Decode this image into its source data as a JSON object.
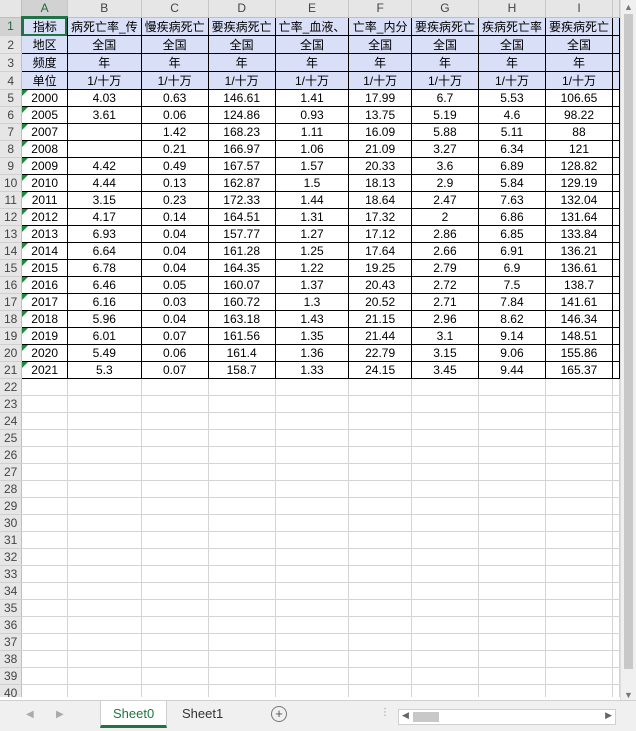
{
  "columns": [
    "A",
    "B",
    "C",
    "D",
    "E",
    "F",
    "G",
    "H",
    "I"
  ],
  "header_rows": [
    [
      "指标",
      "病死亡率_传",
      "慢疾病死亡",
      "要疾病死亡",
      "亡率_血液、",
      "亡率_内分",
      "要疾病死亡",
      "疾病死亡率",
      "要疾病死亡"
    ],
    [
      "地区",
      "全国",
      "全国",
      "全国",
      "全国",
      "全国",
      "全国",
      "全国",
      "全国"
    ],
    [
      "频度",
      "年",
      "年",
      "年",
      "年",
      "年",
      "年",
      "年",
      "年"
    ],
    [
      "单位",
      "1/十万",
      "1/十万",
      "1/十万",
      "1/十万",
      "1/十万",
      "1/十万",
      "1/十万",
      "1/十万"
    ]
  ],
  "data_rows": [
    [
      "2000",
      "4.03",
      "0.63",
      "146.61",
      "1.41",
      "17.99",
      "6.7",
      "5.53",
      "106.65"
    ],
    [
      "2005",
      "3.61",
      "0.06",
      "124.86",
      "0.93",
      "13.75",
      "5.19",
      "4.6",
      "98.22"
    ],
    [
      "2007",
      "",
      "1.42",
      "168.23",
      "1.11",
      "16.09",
      "5.88",
      "5.11",
      "88"
    ],
    [
      "2008",
      "",
      "0.21",
      "166.97",
      "1.06",
      "21.09",
      "3.27",
      "6.34",
      "121"
    ],
    [
      "2009",
      "4.42",
      "0.49",
      "167.57",
      "1.57",
      "20.33",
      "3.6",
      "6.89",
      "128.82"
    ],
    [
      "2010",
      "4.44",
      "0.13",
      "162.87",
      "1.5",
      "18.13",
      "2.9",
      "5.84",
      "129.19"
    ],
    [
      "2011",
      "3.15",
      "0.23",
      "172.33",
      "1.44",
      "18.64",
      "2.47",
      "7.63",
      "132.04"
    ],
    [
      "2012",
      "4.17",
      "0.14",
      "164.51",
      "1.31",
      "17.32",
      "2",
      "6.86",
      "131.64"
    ],
    [
      "2013",
      "6.93",
      "0.04",
      "157.77",
      "1.27",
      "17.12",
      "2.86",
      "6.85",
      "133.84"
    ],
    [
      "2014",
      "6.64",
      "0.04",
      "161.28",
      "1.25",
      "17.64",
      "2.66",
      "6.91",
      "136.21"
    ],
    [
      "2015",
      "6.78",
      "0.04",
      "164.35",
      "1.22",
      "19.25",
      "2.79",
      "6.9",
      "136.61"
    ],
    [
      "2016",
      "6.46",
      "0.05",
      "160.07",
      "1.37",
      "20.43",
      "2.72",
      "7.5",
      "138.7"
    ],
    [
      "2017",
      "6.16",
      "0.03",
      "160.72",
      "1.3",
      "20.52",
      "2.71",
      "7.84",
      "141.61"
    ],
    [
      "2018",
      "5.96",
      "0.04",
      "163.18",
      "1.43",
      "21.15",
      "2.96",
      "8.62",
      "146.34"
    ],
    [
      "2019",
      "6.01",
      "0.07",
      "161.56",
      "1.35",
      "21.44",
      "3.1",
      "9.14",
      "148.51"
    ],
    [
      "2020",
      "5.49",
      "0.06",
      "161.4",
      "1.36",
      "22.79",
      "3.15",
      "9.06",
      "155.86"
    ],
    [
      "2021",
      "5.3",
      "0.07",
      "158.7",
      "1.33",
      "24.15",
      "3.45",
      "9.44",
      "165.37"
    ]
  ],
  "total_rows": 40,
  "sheets": [
    "Sheet0",
    "Sheet1"
  ],
  "active_sheet": "Sheet0",
  "icons": {
    "add_sheet": "plus-circle-icon",
    "scroll_left": "triangle-left-icon",
    "scroll_right": "triangle-right-icon",
    "scroll_up": "triangle-up-icon",
    "scroll_down": "triangle-down-icon"
  },
  "colors": {
    "accent": "#217346",
    "header_fill": "#d9dff7",
    "triangle": "#1f8a3c"
  }
}
